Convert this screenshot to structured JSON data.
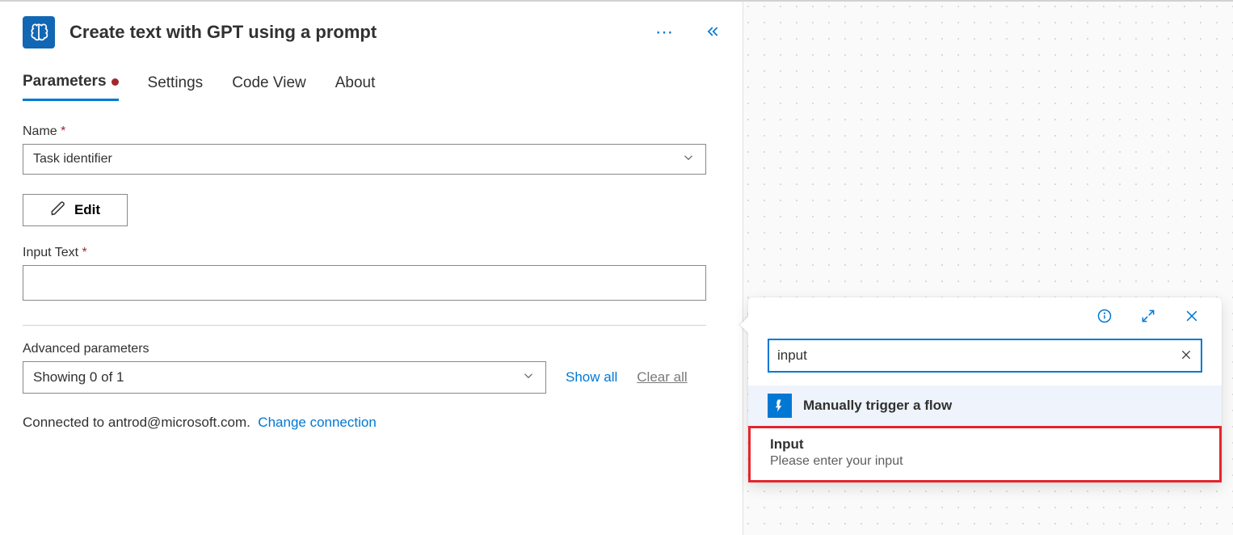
{
  "header": {
    "title": "Create text with GPT using a prompt"
  },
  "tabs": [
    {
      "label": "Parameters",
      "active": true,
      "has_error": true
    },
    {
      "label": "Settings"
    },
    {
      "label": "Code View"
    },
    {
      "label": "About"
    }
  ],
  "fields": {
    "name_label": "Name",
    "name_value": "Task identifier",
    "edit_label": "Edit",
    "input_text_label": "Input Text",
    "input_text_value": ""
  },
  "advanced": {
    "label": "Advanced parameters",
    "select_text": "Showing 0 of 1",
    "show_all": "Show all",
    "clear_all": "Clear all"
  },
  "connection": {
    "prefix": "Connected to ",
    "email": "antrod@microsoft.com.",
    "change_label": "Change connection"
  },
  "popup": {
    "search_value": "input",
    "group_label": "Manually trigger a flow",
    "result": {
      "title": "Input",
      "subtitle": "Please enter your input"
    }
  }
}
